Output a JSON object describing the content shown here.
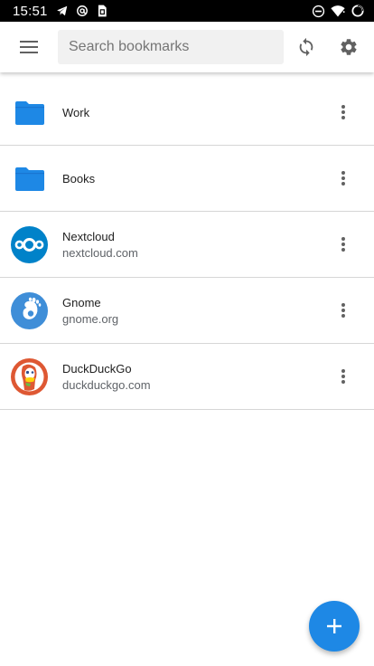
{
  "status_bar": {
    "time": "15:51",
    "left_icons": [
      "telegram-icon",
      "at-sign-icon",
      "sim-card-icon"
    ],
    "right_icons": [
      "do-not-disturb-icon",
      "wifi-icon",
      "battery-charging-icon"
    ]
  },
  "app_bar": {
    "menu_icon": "hamburger-menu-icon",
    "search": {
      "placeholder": "Search bookmarks",
      "value": ""
    },
    "sync_icon": "sync-icon",
    "settings_icon": "gear-icon"
  },
  "bookmarks": [
    {
      "type": "folder",
      "title": "Work",
      "subtitle": "",
      "icon": "folder-icon"
    },
    {
      "type": "folder",
      "title": "Books",
      "subtitle": "",
      "icon": "folder-icon"
    },
    {
      "type": "bookmark",
      "title": "Nextcloud",
      "subtitle": "nextcloud.com",
      "icon": "nextcloud-logo-icon"
    },
    {
      "type": "bookmark",
      "title": "Gnome",
      "subtitle": "gnome.org",
      "icon": "gnome-logo-icon"
    },
    {
      "type": "bookmark",
      "title": "DuckDuckGo",
      "subtitle": "duckduckgo.com",
      "icon": "duckduckgo-logo-icon"
    }
  ],
  "fab": {
    "icon": "plus-icon"
  },
  "colors": {
    "accent": "#1e88e5",
    "folder": "#1e88e5",
    "nextcloud": "#0082c9",
    "gnome": "#3f8ed8",
    "duckduckgo": "#de5833",
    "divider": "#d6d6d6",
    "icon_gray": "#616161"
  }
}
